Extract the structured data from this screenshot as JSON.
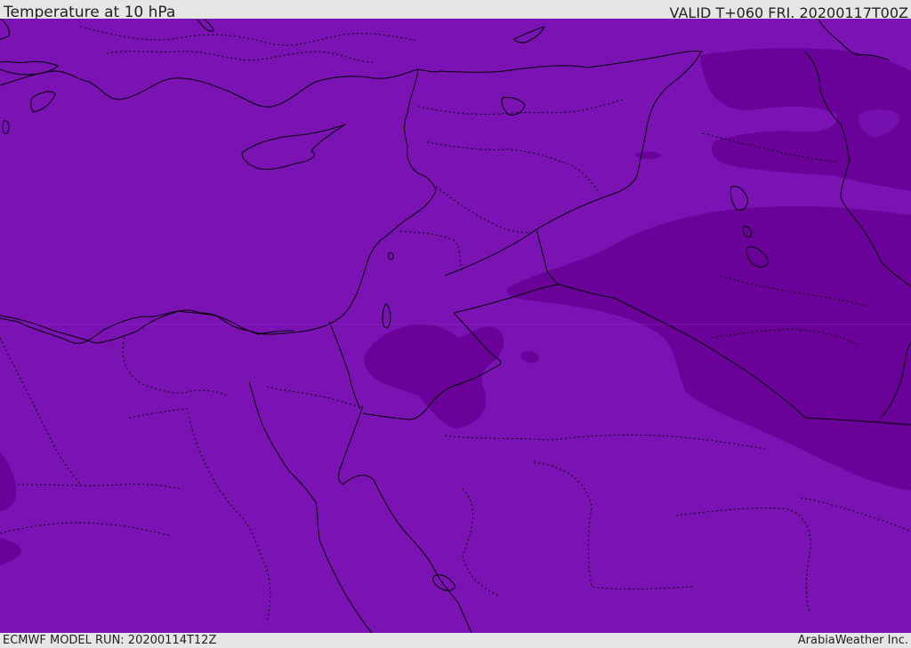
{
  "header": {
    "title": "Temperature at 10 hPa",
    "valid": "VALID T+060 FRI. 20200117T00Z"
  },
  "footer": {
    "model_run": "ECMWF MODEL RUN: 20200114T12Z",
    "credit": "ArabiaWeather Inc."
  },
  "colors": {
    "field_base": "#7a12b4",
    "field_cold": "#6a0199",
    "field_mid": "#7410ad",
    "coastline": "#000000",
    "frame_bg": "#e6e6e6"
  }
}
